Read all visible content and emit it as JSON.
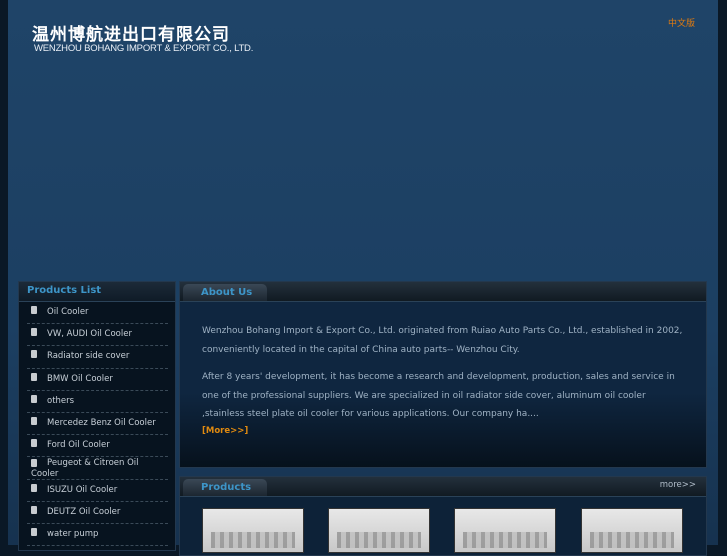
{
  "header": {
    "logo_cn": "温州博航进出口有限公司",
    "logo_en": "WENZHOU BOHANG IMPORT & EXPORT CO., LTD.",
    "lang_link": "中文版"
  },
  "sidebar": {
    "title": "Products List",
    "items": [
      {
        "label": "Oil Cooler"
      },
      {
        "label": "VW, AUDI Oil Cooler"
      },
      {
        "label": "Radiator side cover"
      },
      {
        "label": "BMW Oil Cooler"
      },
      {
        "label": "others"
      },
      {
        "label": "Mercedez Benz Oil Cooler"
      },
      {
        "label": "Ford Oil Cooler"
      },
      {
        "label": "Peugeot & Citroen Oil Cooler"
      },
      {
        "label": "ISUZU Oil Cooler"
      },
      {
        "label": "DEUTZ Oil Cooler"
      },
      {
        "label": "water pump"
      }
    ]
  },
  "about": {
    "title": "About Us",
    "p1": "Wenzhou Bohang Import & Export Co., Ltd. originated from Ruiao Auto Parts Co., Ltd., established in 2002, conveniently located in the capital of China auto parts-- Wenzhou City.",
    "p2": "After 8 years' development, it has become a research and development, production, sales and service in one of the professional suppliers. We are specialized in oil radiator side cover, aluminum oil cooler ,stainless steel plate oil cooler for various applications. Our company ha....",
    "more": "[More>>]"
  },
  "products": {
    "title": "Products",
    "more": "more>>"
  }
}
